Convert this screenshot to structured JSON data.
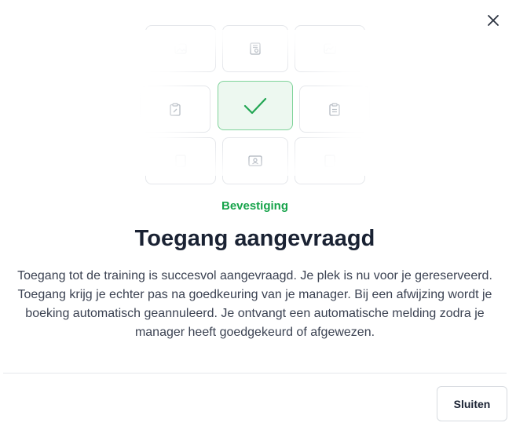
{
  "dialog": {
    "close_icon": "close-icon",
    "eyebrow": "Bevestiging",
    "title": "Toegang aangevraagd",
    "body": "Toegang tot de training is succesvol aangevraagd. Je plek is nu voor je gereserveerd. Toegang krijg je echter pas na goedkeuring van je manager. Bij een afwijzing wordt je boeking automatisch geannuleerd. Je ontvangt een automatische melding zodra je manager heeft goedgekeurd of afgewezen.",
    "close_button_label": "Sluiten"
  },
  "illustration": {
    "center_icon": "checkmark-icon",
    "tile_icons": [
      "image-icon",
      "certificate-icon",
      "chart-icon",
      "clipboard-edit-icon",
      "clipboard-check-icon",
      "document-icon",
      "id-card-icon",
      "document-icon"
    ]
  },
  "colors": {
    "accent_green": "#16a34a",
    "success_bg": "#edf8f0",
    "title": "#1a2233"
  }
}
